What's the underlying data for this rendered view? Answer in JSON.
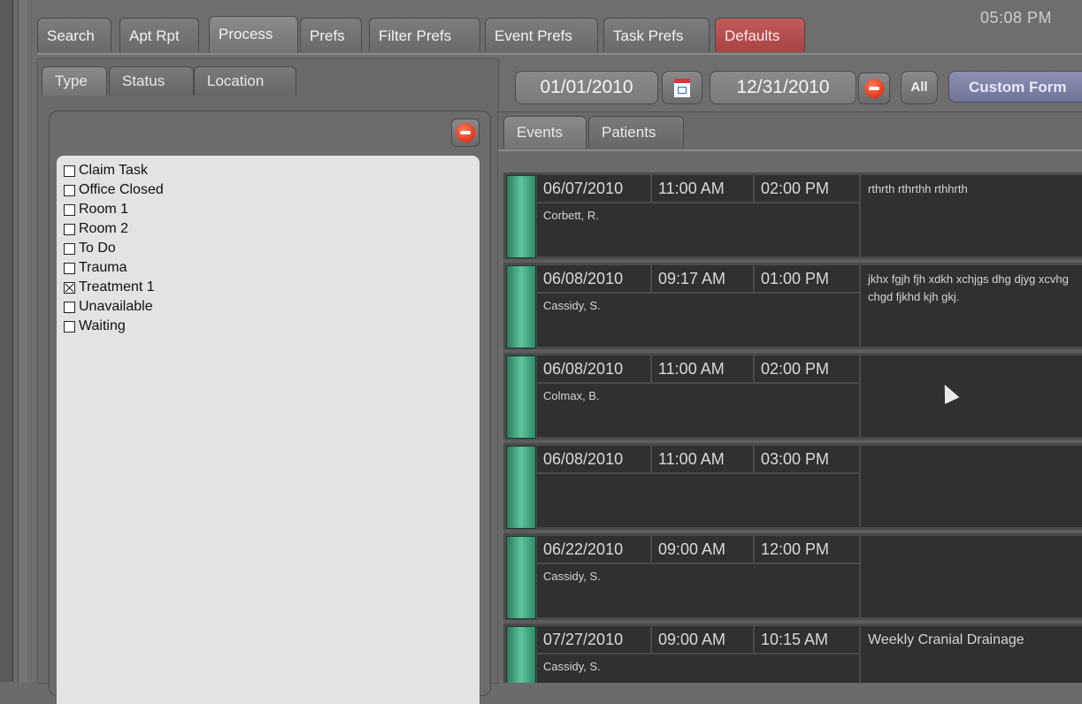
{
  "window": {
    "tabs": [
      "Search",
      "Apt Rpt",
      "Process",
      "Prefs",
      "Filter Prefs",
      "Event Prefs",
      "Task Prefs",
      "Defaults"
    ],
    "active_tab": "Process",
    "clock": "05:08 PM"
  },
  "left_panel": {
    "subtabs": [
      "Type",
      "Status",
      "Location"
    ],
    "active_subtab": "Type",
    "types": [
      {
        "label": "Claim Task",
        "checked": false
      },
      {
        "label": "Office Closed",
        "checked": false
      },
      {
        "label": "Room 1",
        "checked": false
      },
      {
        "label": "Room 2",
        "checked": false
      },
      {
        "label": "To Do",
        "checked": false
      },
      {
        "label": "Trauma",
        "checked": false
      },
      {
        "label": "Treatment 1",
        "checked": true
      },
      {
        "label": "Unavailable",
        "checked": false
      },
      {
        "label": "Waiting",
        "checked": false
      }
    ]
  },
  "date_range": {
    "start": "01/01/2010",
    "end": "12/31/2010",
    "all_label": "All",
    "custom_label": "Custom Form"
  },
  "events_panel": {
    "tabs": [
      "Events",
      "Patients"
    ],
    "active_tab": "Events",
    "events": [
      {
        "date": "06/07/2010",
        "start": "11:00 AM",
        "end": "02:00 PM",
        "patient": "Corbett, R.",
        "note": "rthrth rthrthh rthhrth"
      },
      {
        "date": "06/08/2010",
        "start": "09:17 AM",
        "end": "01:00 PM",
        "patient": "Cassidy, S.",
        "note": "jkhx fgjh fjh xdkh xchjgs dhg djyg xcvhg chgd fjkhd kjh gkj."
      },
      {
        "date": "06/08/2010",
        "start": "11:00 AM",
        "end": "02:00 PM",
        "patient": "Colmax, B.",
        "note": ""
      },
      {
        "date": "06/08/2010",
        "start": "11:00 AM",
        "end": "03:00 PM",
        "patient": "",
        "note": ""
      },
      {
        "date": "06/22/2010",
        "start": "09:00 AM",
        "end": "12:00 PM",
        "patient": "Cassidy, S.",
        "note": ""
      },
      {
        "date": "07/27/2010",
        "start": "09:00 AM",
        "end": "10:15 AM",
        "patient": "Cassidy, S.",
        "note": "Weekly Cranial Drainage"
      }
    ]
  },
  "colors": {
    "defaults_tab": "#b24b4b",
    "event_bar": "#4fae88",
    "custom_button": "#7f83a8"
  }
}
